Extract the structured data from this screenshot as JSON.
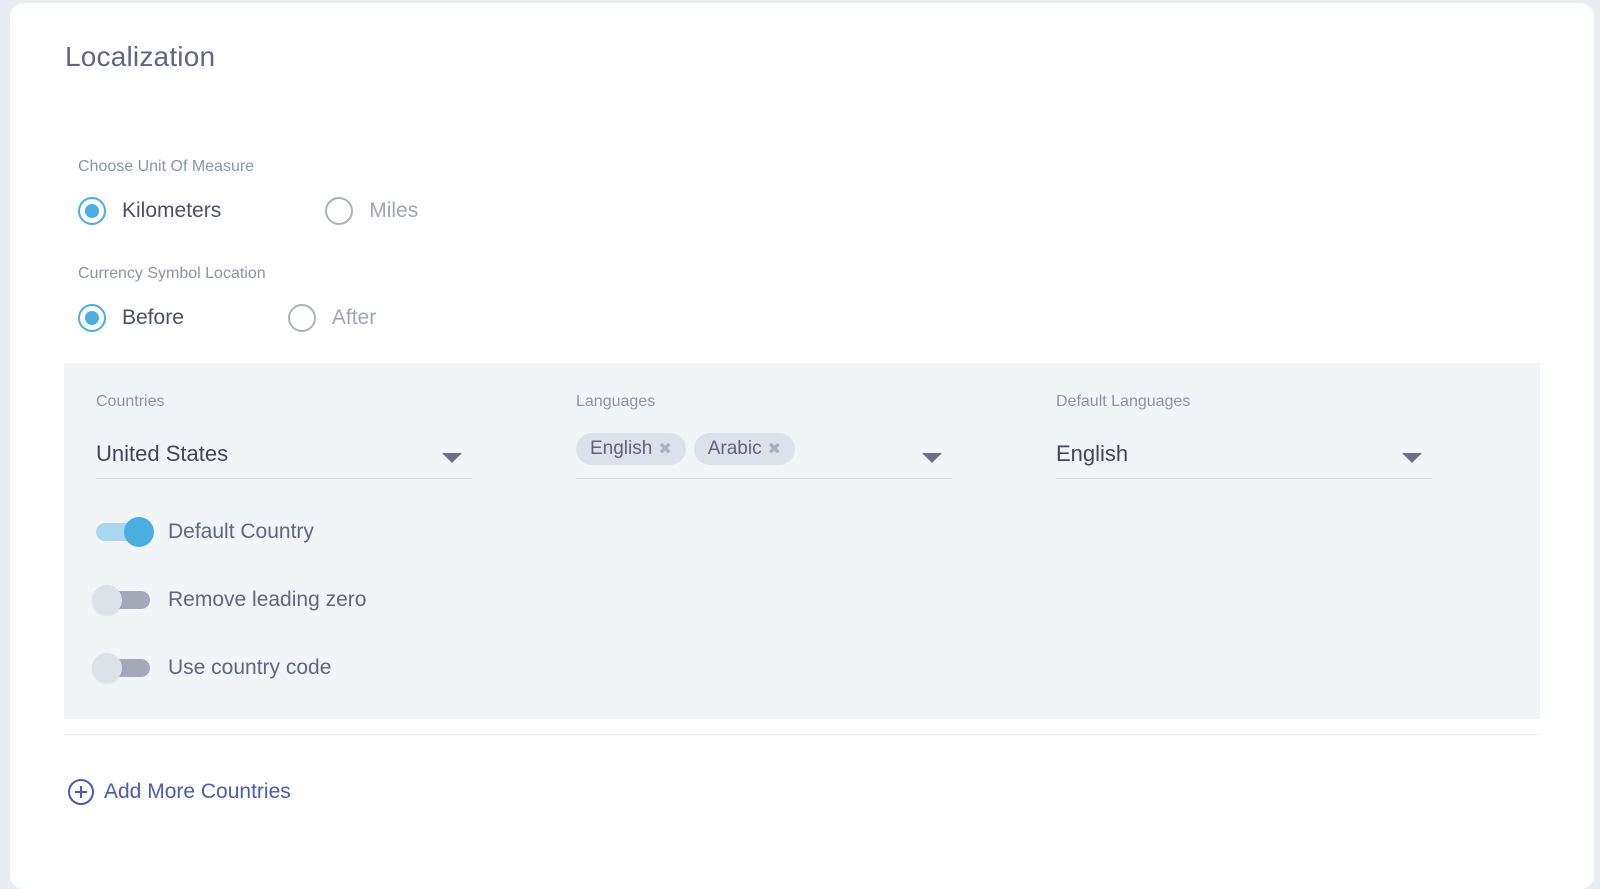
{
  "page": {
    "title": "Localization"
  },
  "unit_of_measure": {
    "label": "Choose Unit Of Measure",
    "options": [
      {
        "label": "Kilometers",
        "selected": true
      },
      {
        "label": "Miles",
        "selected": false
      }
    ]
  },
  "currency_symbol": {
    "label": "Currency Symbol Location",
    "options": [
      {
        "label": "Before",
        "selected": true
      },
      {
        "label": "After",
        "selected": false
      }
    ]
  },
  "country_block": {
    "countries": {
      "label": "Countries",
      "value": "United States"
    },
    "languages": {
      "label": "Languages",
      "tags": [
        "English",
        "Arabic"
      ]
    },
    "default_languages": {
      "label": "Default Languages",
      "value": "English"
    },
    "toggles": [
      {
        "label": "Default Country",
        "on": true
      },
      {
        "label": "Remove leading zero",
        "on": false
      },
      {
        "label": "Use country code",
        "on": false
      }
    ]
  },
  "add_more": {
    "label": "Add More Countries"
  },
  "colors": {
    "accent": "#4aaee0",
    "link": "#4a5ea8",
    "panel_bg": "#f2f5f8"
  }
}
